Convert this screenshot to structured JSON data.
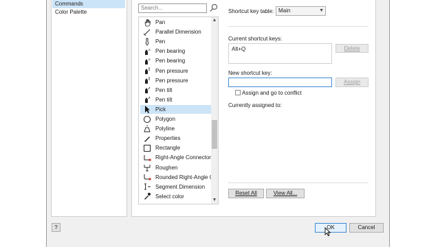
{
  "categories": [
    {
      "label": "Commands",
      "selected": true
    },
    {
      "label": "Color Palette",
      "selected": false
    }
  ],
  "search": {
    "placeholder": "Search..."
  },
  "commands": [
    {
      "label": "Pan",
      "icon": "hand-icon",
      "selected": false
    },
    {
      "label": "Parallel Dimension",
      "icon": "dimension-line-icon",
      "selected": false
    },
    {
      "label": "Pen",
      "icon": "pen-icon",
      "selected": false
    },
    {
      "label": "Pen bearing",
      "icon": "pen-bearing-icon",
      "selected": false
    },
    {
      "label": "Pen bearing",
      "icon": "pen-bearing-icon",
      "selected": false
    },
    {
      "label": "Pen pressure",
      "icon": "pen-pressure-icon",
      "selected": false
    },
    {
      "label": "Pen pressure",
      "icon": "pen-pressure-icon",
      "selected": false
    },
    {
      "label": "Pen tilt",
      "icon": "pen-tilt-icon",
      "selected": false
    },
    {
      "label": "Pen tilt",
      "icon": "pen-tilt-icon",
      "selected": false
    },
    {
      "label": "Pick",
      "icon": "pick-arrow-icon",
      "selected": true
    },
    {
      "label": "Polygon",
      "icon": "polygon-icon",
      "selected": false
    },
    {
      "label": "Polyline",
      "icon": "polyline-icon",
      "selected": false
    },
    {
      "label": "Properties",
      "icon": "properties-icon",
      "selected": false
    },
    {
      "label": "Rectangle",
      "icon": "rectangle-icon",
      "selected": false
    },
    {
      "label": "Right-Angle Connector",
      "icon": "right-angle-connector-icon",
      "selected": false
    },
    {
      "label": "Roughen",
      "icon": "roughen-icon",
      "selected": false
    },
    {
      "label": "Rounded Right-Angle C...",
      "icon": "rounded-connector-icon",
      "selected": false
    },
    {
      "label": "Segment Dimension",
      "icon": "segment-dimension-icon",
      "selected": false
    },
    {
      "label": "Select color",
      "icon": "eyedropper-icon",
      "selected": false
    }
  ],
  "shortcut": {
    "table_label": "Shortcut key table:",
    "table_value": "Main",
    "current_label": "Current shortcut keys:",
    "current_value": "Alt+Q",
    "delete_label": "Delete",
    "new_label": "New shortcut key:",
    "new_value": "",
    "assign_label": "Assign",
    "assign_goto_label": "Assign and go to conflict",
    "assigned_label": "Currently assigned to:",
    "reset_label": "Reset All",
    "view_label": "View All..."
  },
  "footer": {
    "help_label": "?",
    "ok_label": "OK",
    "cancel_label": "Cancel"
  },
  "colors": {
    "selection": "#cce4f7",
    "focus_border": "#3e8ad6"
  }
}
